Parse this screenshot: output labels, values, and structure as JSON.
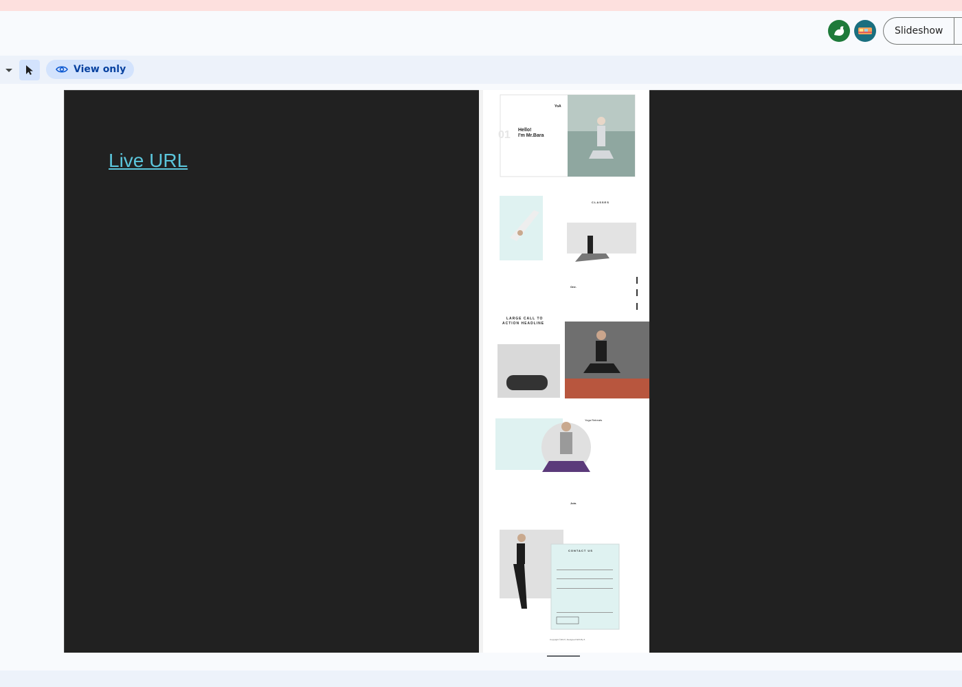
{
  "header": {
    "slideshow_label": "Slideshow"
  },
  "toolbar": {
    "view_only_label": "View only"
  },
  "slide": {
    "live_url_text": "Live URL",
    "mockup": {
      "brand": "YoA",
      "hero_greeting": "Hello!",
      "hero_name": "I'm Mr.Bara",
      "hero_number": "01",
      "classes_title": "CLASSES",
      "one_label": "One.",
      "cta_line1": "LARGE CALL TO",
      "cta_line2": "ACTION HEADLINE",
      "yoga_retreats": "Yoga Retreats",
      "join_label": "Join.",
      "contact_title": "CONTACT US",
      "footer": "Copyright ©2017 | Designed With By 5"
    }
  },
  "colors": {
    "slide_bg": "#212121",
    "link": "#5bc6dc",
    "mint": "#dff2f1",
    "banner": "#fde0de"
  }
}
